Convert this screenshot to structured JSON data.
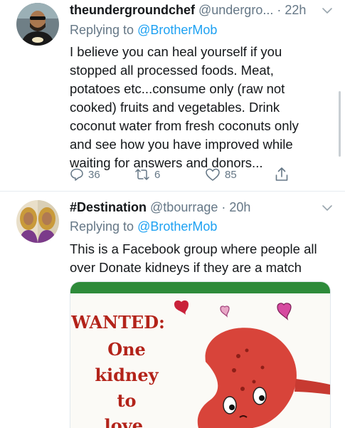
{
  "tweets": [
    {
      "display_name": "theundergroundchef",
      "handle_time": " @undergro... · 22h",
      "replying_prefix": "Replying to ",
      "replying_mention": "@BrotherMob",
      "body_lines": [
        "I believe you can heal yourself if you",
        "stopped all processed foods. Meat,",
        "potatoes etc...consume only (raw not",
        "cooked) fruits and vegetables. Drink",
        "coconut water from fresh coconuts only",
        "and see how you have improved while",
        "waiting for answers and donors..."
      ],
      "actions": {
        "reply_count": "36",
        "retweet_count": "6",
        "like_count": "85"
      },
      "icons": [
        "avatar",
        "chevron-down-icon",
        "reply-icon",
        "retweet-icon",
        "like-icon",
        "share-icon"
      ]
    },
    {
      "display_name": "#Destination",
      "handle_time": " @tbourrage · 20h",
      "replying_prefix": "Replying to ",
      "replying_mention": "@BrotherMob",
      "body_lines": [
        "This is a Facebook group where people all",
        "over Donate kidneys if they are a match"
      ],
      "media": {
        "poster_lines": [
          "WANTED:",
          "One",
          "kidney",
          "to",
          "love."
        ]
      },
      "icons": [
        "avatar",
        "chevron-down-icon"
      ]
    }
  ],
  "colors": {
    "text": "#14171a",
    "secondary": "#657786",
    "link": "#1da1f2",
    "poster_red": "#b3231a",
    "kidney": "#d8443a",
    "banner_green": "#2e8b3a"
  }
}
